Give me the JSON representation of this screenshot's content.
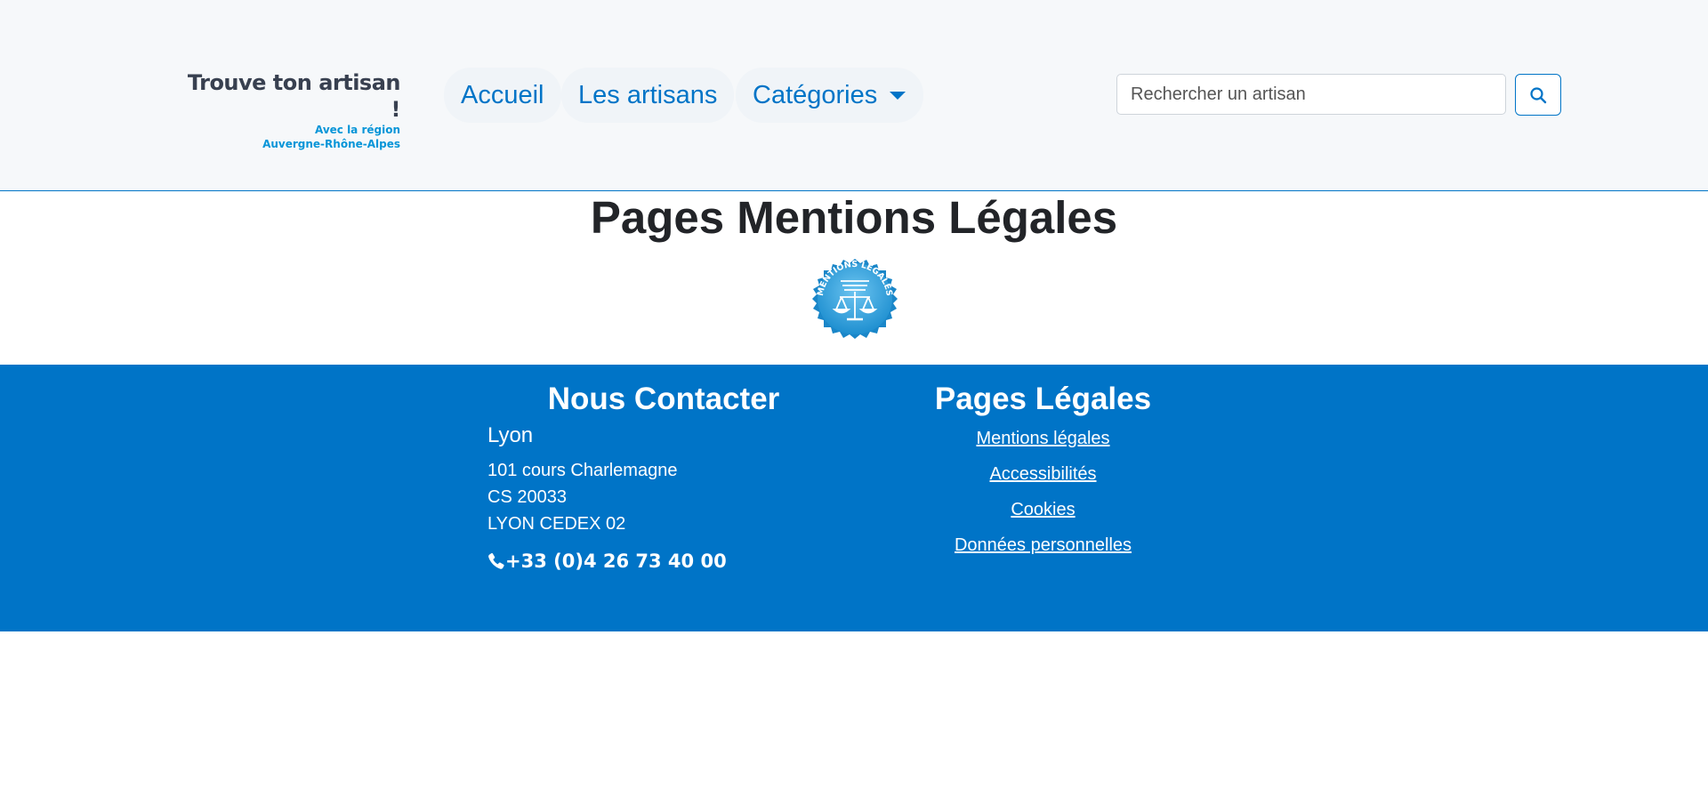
{
  "header": {
    "logo": {
      "title": "Trouve ton artisan !",
      "sub_line1": "Avec la région",
      "sub_line2": "Auvergne-Rhône-Alpes"
    },
    "nav": {
      "home": "Accueil",
      "artisans": "Les artisans",
      "categories": "Catégories"
    },
    "search": {
      "placeholder": "Rechercher un artisan",
      "value": "",
      "button_icon": "search-icon"
    }
  },
  "main": {
    "title": "Pages Mentions Légales",
    "badge": {
      "text": "MENTIONS LÉGALES",
      "icon": "scales-icon"
    }
  },
  "footer": {
    "contact": {
      "title": "Nous Contacter",
      "city": "Lyon",
      "address": [
        "101 cours Charlemagne",
        "CS 20033",
        "LYON CEDEX 02"
      ],
      "phone_icon": "phone-icon",
      "phone": "+33 (0)4 26 73 40 00"
    },
    "legal": {
      "title": "Pages Légales",
      "links": [
        "Mentions légales",
        "Accessibilités",
        "Cookies",
        "Données personnelles"
      ]
    }
  },
  "colors": {
    "brand_blue": "#0074c7",
    "logo_accent": "#0795d8",
    "header_bg": "#f6f8fa"
  }
}
